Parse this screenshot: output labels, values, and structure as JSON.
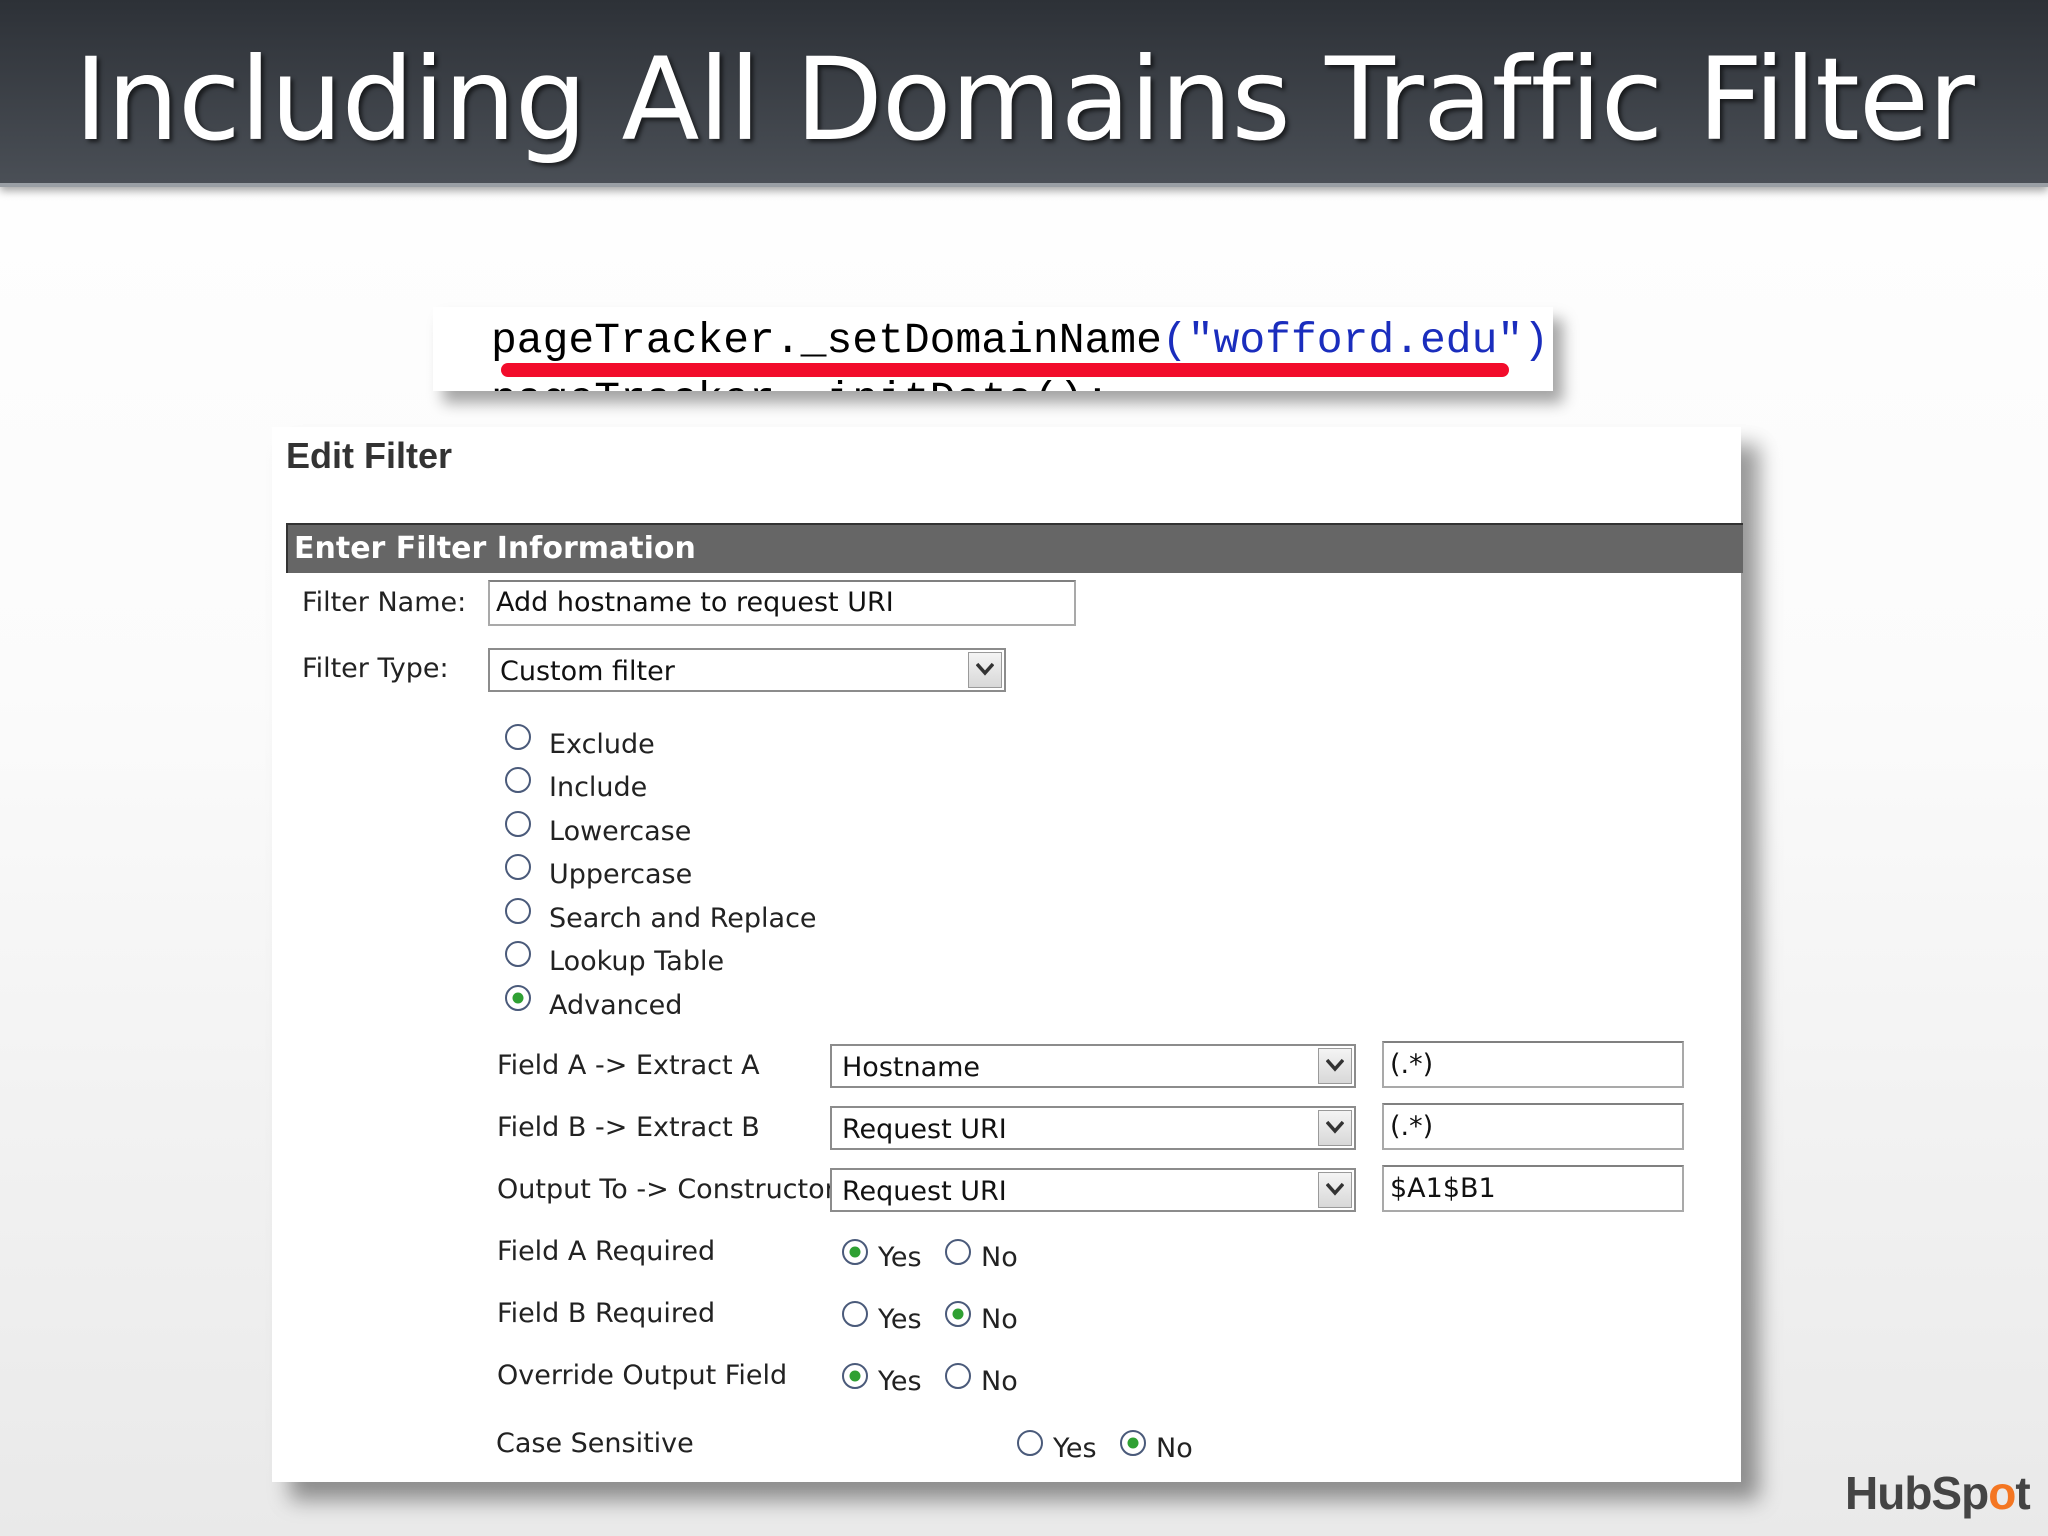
{
  "slide": {
    "title": "Including All Domains Traffic Filter",
    "code_line1_prefix": "pageTracker._setDomainName",
    "code_line1_open": "(",
    "code_line1_string": "\"wofford.edu\"",
    "code_line1_close": ")",
    "code_line1_end": ";",
    "code_line2": "pageTracker._initData();",
    "logo_part1": "HubSp",
    "logo_part2": "o",
    "logo_part3": "t"
  },
  "panel": {
    "title": "Edit Filter",
    "section_header": "Enter Filter Information",
    "filter_name_label": "Filter Name:",
    "filter_name_value": "Add hostname to request URI",
    "filter_type_label": "Filter Type:",
    "filter_type_value": "Custom filter",
    "custom_options": [
      "Exclude",
      "Include",
      "Lowercase",
      "Uppercase",
      "Search and Replace",
      "Lookup Table",
      "Advanced"
    ],
    "selected_custom_option": "Advanced",
    "advanced": {
      "field_a_label": "Field A -> Extract A",
      "field_a_select": "Hostname",
      "field_a_extract": "(.*)",
      "field_b_label": "Field B -> Extract B",
      "field_b_select": "Request URI",
      "field_b_extract": "(.*)",
      "output_label": "Output To -> Constructor",
      "output_select": "Request URI",
      "output_constructor": "$A1$B1"
    },
    "toggles": [
      {
        "label": "Field A Required",
        "yes": "Yes",
        "no": "No",
        "selected": "Yes"
      },
      {
        "label": "Field B Required",
        "yes": "Yes",
        "no": "No",
        "selected": "No"
      },
      {
        "label": "Override Output Field",
        "yes": "Yes",
        "no": "No",
        "selected": "Yes"
      },
      {
        "label": "Case Sensitive",
        "yes": "Yes",
        "no": "No",
        "selected": "No"
      }
    ]
  }
}
